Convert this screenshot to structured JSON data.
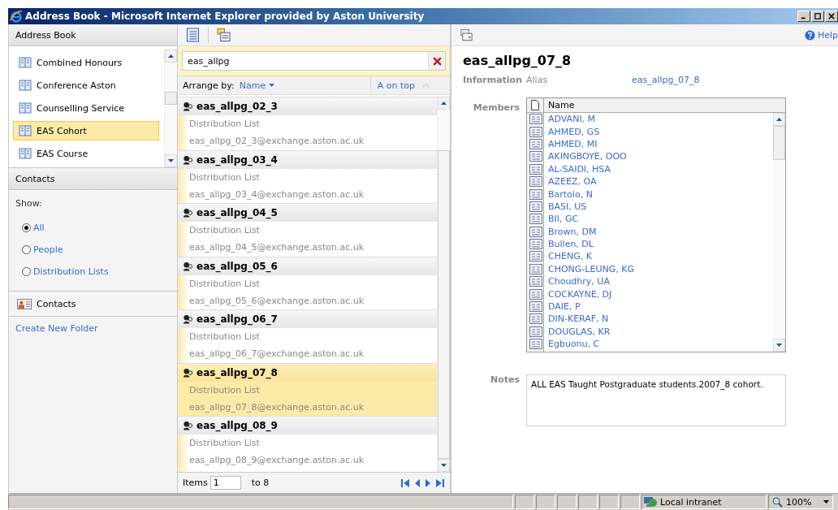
{
  "window": {
    "title": "Address Book - Microsoft Internet Explorer provided by Aston University"
  },
  "sidebar": {
    "header": "Address Book",
    "folders": [
      {
        "label": "Combined Honours",
        "selected": false
      },
      {
        "label": "Conference Aston",
        "selected": false
      },
      {
        "label": "Counselling Service",
        "selected": false
      },
      {
        "label": "EAS Cohort",
        "selected": true
      },
      {
        "label": "EAS Course",
        "selected": false
      }
    ],
    "contacts_header": "Contacts",
    "show_label": "Show:",
    "show_options": [
      {
        "label": "All",
        "selected": true
      },
      {
        "label": "People",
        "selected": false
      },
      {
        "label": "Distribution Lists",
        "selected": false
      }
    ],
    "contacts_folder": "Contacts",
    "create_link": "Create New Folder"
  },
  "list": {
    "search": "eas_allpg",
    "arrange_label": "Arrange by:",
    "arrange_value": "Name",
    "order": "A on top",
    "entries": [
      {
        "name": "eas_allpg_02_3",
        "type": "Distribution List",
        "email": "eas_allpg_02_3@exchange.aston.ac.uk",
        "selected": false
      },
      {
        "name": "eas_allpg_03_4",
        "type": "Distribution List",
        "email": "eas_allpg_03_4@exchange.aston.ac.uk",
        "selected": false
      },
      {
        "name": "eas_allpg_04_5",
        "type": "Distribution List",
        "email": "eas_allpg_04_5@exchange.aston.ac.uk",
        "selected": false
      },
      {
        "name": "eas_allpg_05_6",
        "type": "Distribution List",
        "email": "eas_allpg_05_6@exchange.aston.ac.uk",
        "selected": false
      },
      {
        "name": "eas_allpg_06_7",
        "type": "Distribution List",
        "email": "eas_allpg_06_7@exchange.aston.ac.uk",
        "selected": false
      },
      {
        "name": "eas_allpg_07_8",
        "type": "Distribution List",
        "email": "eas_allpg_07_8@exchange.aston.ac.uk",
        "selected": true
      },
      {
        "name": "eas_allpg_08_9",
        "type": "Distribution List",
        "email": "eas_allpg_08_9@exchange.aston.ac.uk",
        "selected": false
      }
    ],
    "items_label": "Items",
    "items_from": "1",
    "items_to": "to 8"
  },
  "detail": {
    "help": "Help",
    "title": "eas_allpg_07_8",
    "information_label": "Information",
    "alias_label": "Alias",
    "alias": "eas_allpg_07_8",
    "members_label": "Members",
    "members_column": "Name",
    "members": [
      "ADVANI, M",
      "AHMED, GS",
      "AHMED, MI",
      "AKINGBOYE, OOO",
      "AL-SAIDI, HSA",
      "AZEEZ, OA",
      "Bartolo, N",
      "BASI, US",
      "BII, GC",
      "Brown, DM",
      "Bullen, DL",
      "CHENG, K",
      "CHONG-LEUNG, KG",
      "Choudhry, UA",
      "COCKAYNE, DJ",
      "DAIE, P",
      "DIN-KERAF, N",
      "DOUGLAS, KR",
      "Egbuonu, C"
    ],
    "notes_label": "Notes",
    "notes": "ALL EAS Taught Postgraduate students.2007_8 cohort."
  },
  "status_bar": {
    "zone": "Local intranet",
    "zoom": "100%"
  }
}
